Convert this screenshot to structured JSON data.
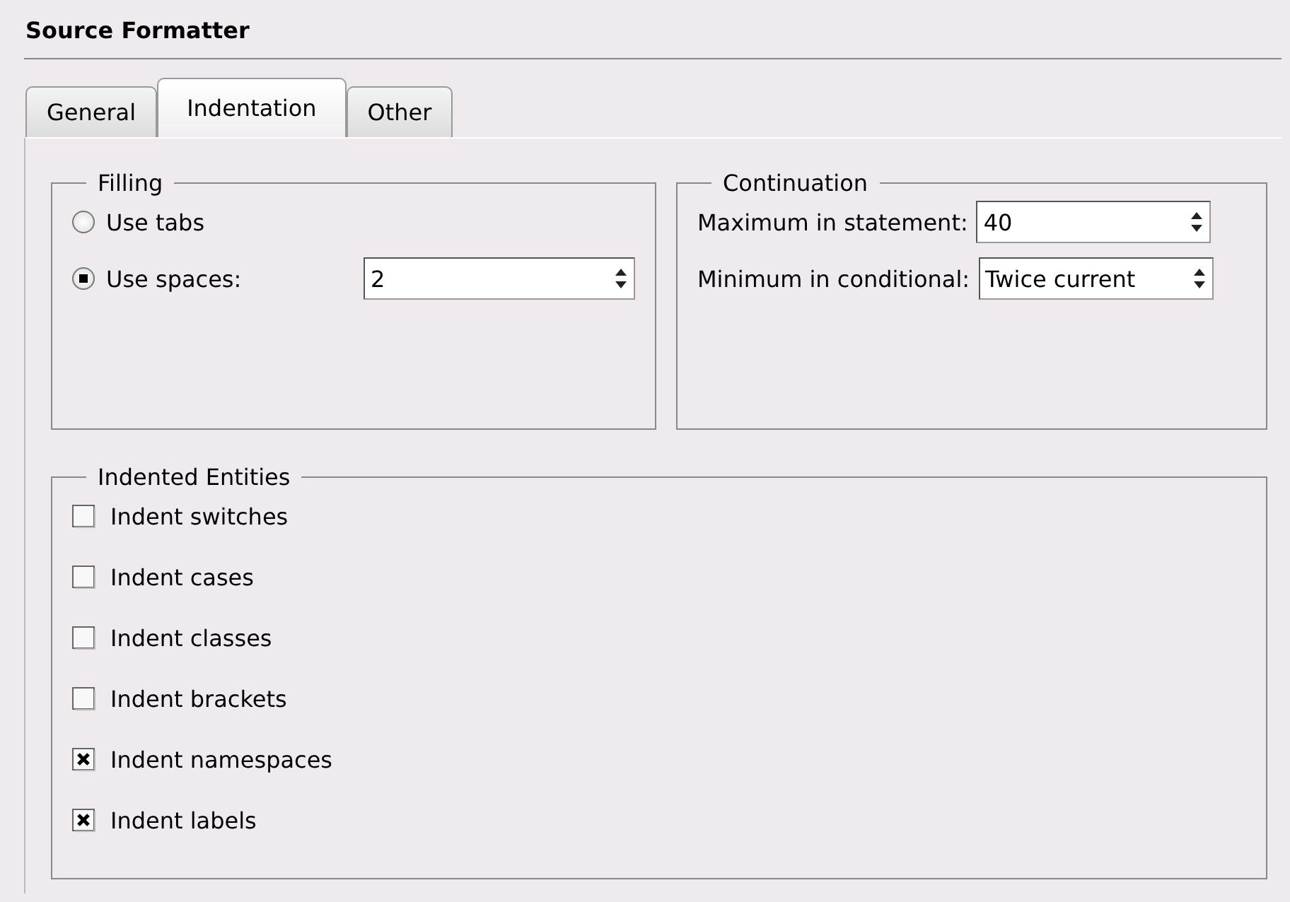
{
  "header": {
    "title": "Source Formatter"
  },
  "tabs": [
    {
      "label": "General",
      "selected": false
    },
    {
      "label": "Indentation",
      "selected": true
    },
    {
      "label": "Other",
      "selected": false
    }
  ],
  "filling": {
    "title": "Filling",
    "options": [
      {
        "label": "Use tabs",
        "selected": false
      },
      {
        "label": "Use spaces:",
        "selected": true,
        "value": "2"
      }
    ]
  },
  "continuation": {
    "title": "Continuation",
    "fields": [
      {
        "label": "Maximum in statement:",
        "value": "40"
      },
      {
        "label": "Minimum in conditional:",
        "value": "Twice current"
      }
    ]
  },
  "entities": {
    "title": "Indented Entities",
    "items": [
      {
        "label": "Indent switches",
        "checked": false
      },
      {
        "label": "Indent cases",
        "checked": false
      },
      {
        "label": "Indent classes",
        "checked": false
      },
      {
        "label": "Indent brackets",
        "checked": false
      },
      {
        "label": "Indent namespaces",
        "checked": true
      },
      {
        "label": "Indent labels",
        "checked": true
      }
    ]
  }
}
